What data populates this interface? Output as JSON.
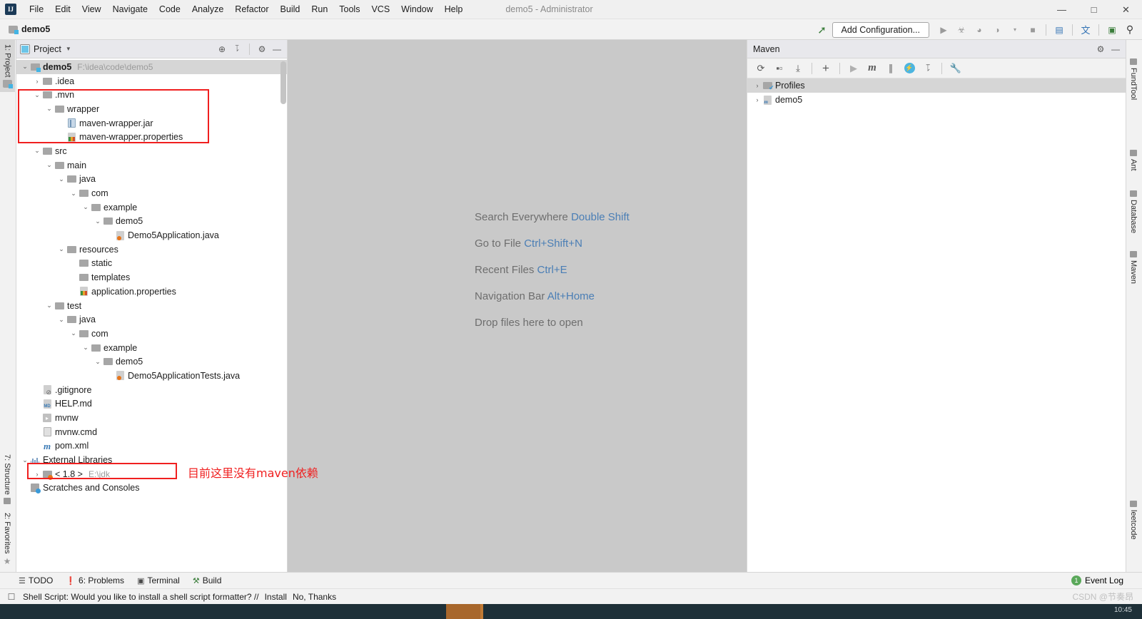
{
  "window": {
    "title": "demo5 - Administrator",
    "logo_text": "IJ",
    "minimize": "—",
    "maximize": "□",
    "close": "✕"
  },
  "menu": {
    "items": [
      "File",
      "Edit",
      "View",
      "Navigate",
      "Code",
      "Analyze",
      "Refactor",
      "Build",
      "Run",
      "Tools",
      "VCS",
      "Window",
      "Help"
    ]
  },
  "navbar": {
    "breadcrumb": "demo5",
    "add_configuration": "Add Configuration...",
    "icons": [
      {
        "name": "build-hammer-icon",
        "glyph": "⚑"
      },
      {
        "name": "run-icon",
        "glyph": "▶"
      },
      {
        "name": "debug-icon",
        "glyph": "☸"
      },
      {
        "name": "run-coverage-icon",
        "glyph": "◔"
      },
      {
        "name": "profile-icon",
        "glyph": "◑"
      },
      {
        "name": "dropdown-icon",
        "glyph": "▾"
      },
      {
        "name": "stop-icon",
        "glyph": "■"
      },
      {
        "name": "project-structure-icon",
        "glyph": "▤"
      },
      {
        "name": "translate-icon",
        "glyph": "文"
      },
      {
        "name": "terminal-icon",
        "glyph": "▣"
      },
      {
        "name": "search-icon",
        "glyph": "⌕"
      }
    ]
  },
  "left_strip": {
    "top": [
      {
        "label": "1: Project",
        "icon": "project-folder-icon",
        "selected": true
      }
    ],
    "bottom": [
      {
        "label": "7: Structure",
        "icon": "structure-icon",
        "selected": false
      },
      {
        "label": "2: Favorites",
        "icon": "star-icon",
        "selected": false
      }
    ]
  },
  "right_strip": {
    "items": [
      {
        "label": "FundTool",
        "icon": "chart-icon"
      },
      {
        "label": "Ant",
        "icon": "ant-icon"
      },
      {
        "label": "Database",
        "icon": "database-icon"
      },
      {
        "label": "Maven",
        "icon": "maven-icon"
      },
      {
        "label": "leetcode",
        "icon": "leetcode-icon"
      }
    ]
  },
  "project_panel": {
    "title": "Project",
    "header_icons": [
      {
        "name": "locate-icon",
        "glyph": "⊕"
      },
      {
        "name": "collapse-all-icon",
        "glyph": "⩝"
      },
      {
        "name": "gear-icon",
        "glyph": "⚙"
      },
      {
        "name": "hide-icon",
        "glyph": "—"
      }
    ],
    "tree": [
      {
        "indent": 0,
        "arrow": "⌄",
        "icon": "project-root-icon",
        "label": "demo5",
        "bold": true,
        "sub": "F:\\idea\\code\\demo5",
        "selected": true
      },
      {
        "indent": 1,
        "arrow": "›",
        "icon": "folder-icon",
        "label": ".idea"
      },
      {
        "indent": 1,
        "arrow": "⌄",
        "icon": "folder-icon",
        "label": ".mvn"
      },
      {
        "indent": 2,
        "arrow": "⌄",
        "icon": "folder-icon",
        "label": "wrapper"
      },
      {
        "indent": 3,
        "arrow": "",
        "icon": "jar-icon",
        "label": "maven-wrapper.jar"
      },
      {
        "indent": 3,
        "arrow": "",
        "icon": "properties-icon",
        "label": "maven-wrapper.properties"
      },
      {
        "indent": 1,
        "arrow": "⌄",
        "icon": "folder-icon",
        "label": "src"
      },
      {
        "indent": 2,
        "arrow": "⌄",
        "icon": "folder-icon",
        "label": "main"
      },
      {
        "indent": 3,
        "arrow": "⌄",
        "icon": "folder-icon",
        "label": "java"
      },
      {
        "indent": 4,
        "arrow": "⌄",
        "icon": "folder-icon",
        "label": "com"
      },
      {
        "indent": 5,
        "arrow": "⌄",
        "icon": "folder-icon",
        "label": "example"
      },
      {
        "indent": 6,
        "arrow": "⌄",
        "icon": "folder-icon",
        "label": "demo5"
      },
      {
        "indent": 7,
        "arrow": "",
        "icon": "java-class-icon",
        "label": "Demo5Application.java"
      },
      {
        "indent": 3,
        "arrow": "⌄",
        "icon": "folder-icon",
        "label": "resources"
      },
      {
        "indent": 4,
        "arrow": "",
        "icon": "folder-icon",
        "label": "static"
      },
      {
        "indent": 4,
        "arrow": "",
        "icon": "folder-icon",
        "label": "templates"
      },
      {
        "indent": 4,
        "arrow": "",
        "icon": "properties-icon",
        "label": "application.properties"
      },
      {
        "indent": 2,
        "arrow": "⌄",
        "icon": "folder-icon",
        "label": "test"
      },
      {
        "indent": 3,
        "arrow": "⌄",
        "icon": "folder-icon",
        "label": "java"
      },
      {
        "indent": 4,
        "arrow": "⌄",
        "icon": "folder-icon",
        "label": "com"
      },
      {
        "indent": 5,
        "arrow": "⌄",
        "icon": "folder-icon",
        "label": "example"
      },
      {
        "indent": 6,
        "arrow": "⌄",
        "icon": "folder-icon",
        "label": "demo5"
      },
      {
        "indent": 7,
        "arrow": "",
        "icon": "java-class-icon",
        "label": "Demo5ApplicationTests.java"
      },
      {
        "indent": 1,
        "arrow": "",
        "icon": "gitignore-icon",
        "label": ".gitignore"
      },
      {
        "indent": 1,
        "arrow": "",
        "icon": "markdown-icon",
        "label": "HELP.md"
      },
      {
        "indent": 1,
        "arrow": "",
        "icon": "shell-script-icon",
        "label": "mvnw"
      },
      {
        "indent": 1,
        "arrow": "",
        "icon": "cmd-file-icon",
        "label": "mvnw.cmd"
      },
      {
        "indent": 1,
        "arrow": "",
        "icon": "maven-pom-icon",
        "label": "pom.xml"
      },
      {
        "indent": 0,
        "arrow": "⌄",
        "icon": "external-libraries-icon",
        "label": "External Libraries"
      },
      {
        "indent": 1,
        "arrow": "›",
        "icon": "jdk-icon",
        "label": "< 1.8 >",
        "sub": "E:\\jdk"
      },
      {
        "indent": 0,
        "arrow": "",
        "icon": "scratches-icon",
        "label": "Scratches and Consoles"
      }
    ]
  },
  "annotations": {
    "maven_note": "目前这里没有maven依赖",
    "highlight_color": "#f01f1f"
  },
  "editor": {
    "tips": [
      {
        "label": "Search Everywhere",
        "shortcut": "Double Shift"
      },
      {
        "label": "Go to File",
        "shortcut": "Ctrl+Shift+N"
      },
      {
        "label": "Recent Files",
        "shortcut": "Ctrl+E"
      },
      {
        "label": "Navigation Bar",
        "shortcut": "Alt+Home"
      },
      {
        "label": "Drop files here to open",
        "shortcut": ""
      }
    ]
  },
  "maven_panel": {
    "title": "Maven",
    "header_icons": [
      {
        "name": "gear-icon",
        "glyph": "⚙"
      },
      {
        "name": "hide-icon",
        "glyph": "—"
      }
    ],
    "toolbar": [
      {
        "name": "reload-all-maven-projects-icon",
        "glyph": "⟳"
      },
      {
        "name": "generate-sources-icon",
        "glyph": "▰"
      },
      {
        "name": "download-sources-icon",
        "glyph": "⤓"
      },
      {
        "name": "add-maven-project-icon",
        "glyph": "+"
      },
      {
        "name": "run-icon",
        "glyph": "▶"
      },
      {
        "name": "execute-maven-goal-icon",
        "glyph": "m"
      },
      {
        "name": "toggle-skip-tests-icon",
        "glyph": "∤"
      },
      {
        "name": "toggle-offline-mode-icon",
        "glyph": "⚡"
      },
      {
        "name": "collapse-all-icon",
        "glyph": "⩝"
      },
      {
        "name": "maven-settings-icon",
        "glyph": "🔧"
      }
    ],
    "tree": [
      {
        "arrow": "›",
        "icon": "profiles-icon",
        "label": "Profiles",
        "selected": true
      },
      {
        "arrow": "›",
        "icon": "maven-module-icon",
        "label": "demo5",
        "selected": false
      }
    ]
  },
  "tool_window_bar": {
    "items": [
      {
        "label": "TODO",
        "icon": "todo-icon",
        "glyph": "☰"
      },
      {
        "label": "6: Problems",
        "icon": "problems-icon",
        "glyph": "❗"
      },
      {
        "label": "Terminal",
        "icon": "terminal-icon",
        "glyph": "▣"
      },
      {
        "label": "Build",
        "icon": "build-hammer-icon",
        "glyph": "⚒"
      }
    ],
    "event_log": {
      "label": "Event Log",
      "count": "1"
    }
  },
  "status_bar": {
    "icon": "notification-icon",
    "message": "Shell Script: Would you like to install a shell script formatter? //",
    "install_link": "Install",
    "decline_link": "No, Thanks",
    "watermark": "CSDN @节奏昂"
  },
  "taskbar": {
    "clock": "10:45"
  }
}
